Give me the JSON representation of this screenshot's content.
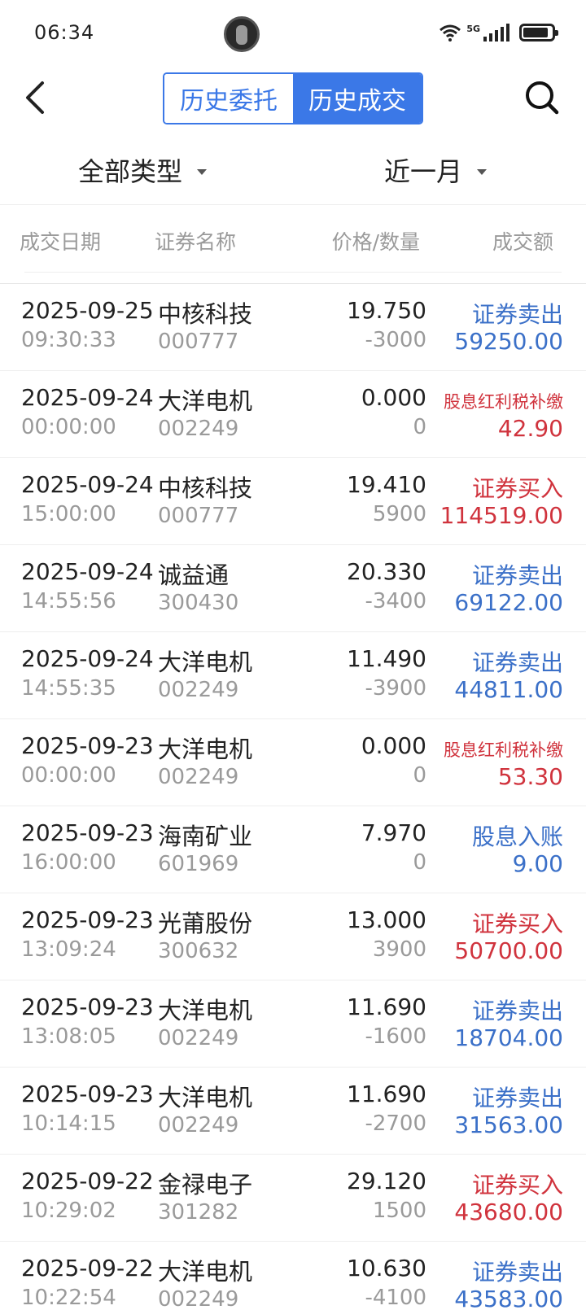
{
  "status": {
    "time": "06:34",
    "network": "5G"
  },
  "header": {
    "tabs": [
      {
        "label": "历史委托",
        "active": false
      },
      {
        "label": "历史成交",
        "active": true
      }
    ],
    "back_icon": "chevron-left-icon",
    "search_icon": "search-icon"
  },
  "filters": {
    "type_label": "全部类型",
    "range_label": "近一月"
  },
  "columns": {
    "date": "成交日期",
    "name": "证券名称",
    "price_qty": "价格/数量",
    "amount": "成交额"
  },
  "colors": {
    "accent": "#3b78e7",
    "sell": "#3b70c8",
    "buy": "#d0333d",
    "muted": "#9a9a9a"
  },
  "rows": [
    {
      "date": "2025-09-25",
      "time": "09:30:33",
      "name": "中核科技",
      "code": "000777",
      "price": "19.750",
      "qty": "-3000",
      "type": "证券卖出",
      "amount": "59250.00",
      "color": "sell"
    },
    {
      "date": "2025-09-24",
      "time": "00:00:00",
      "name": "大洋电机",
      "code": "002249",
      "price": "0.000",
      "qty": "0",
      "type": "股息红利税补缴",
      "amount": "42.90",
      "color": "buy"
    },
    {
      "date": "2025-09-24",
      "time": "15:00:00",
      "name": "中核科技",
      "code": "000777",
      "price": "19.410",
      "qty": "5900",
      "type": "证券买入",
      "amount": "114519.00",
      "color": "buy"
    },
    {
      "date": "2025-09-24",
      "time": "14:55:56",
      "name": "诚益通",
      "code": "300430",
      "price": "20.330",
      "qty": "-3400",
      "type": "证券卖出",
      "amount": "69122.00",
      "color": "sell"
    },
    {
      "date": "2025-09-24",
      "time": "14:55:35",
      "name": "大洋电机",
      "code": "002249",
      "price": "11.490",
      "qty": "-3900",
      "type": "证券卖出",
      "amount": "44811.00",
      "color": "sell"
    },
    {
      "date": "2025-09-23",
      "time": "00:00:00",
      "name": "大洋电机",
      "code": "002249",
      "price": "0.000",
      "qty": "0",
      "type": "股息红利税补缴",
      "amount": "53.30",
      "color": "buy"
    },
    {
      "date": "2025-09-23",
      "time": "16:00:00",
      "name": "海南矿业",
      "code": "601969",
      "price": "7.970",
      "qty": "0",
      "type": "股息入账",
      "amount": "9.00",
      "color": "sell"
    },
    {
      "date": "2025-09-23",
      "time": "13:09:24",
      "name": "光莆股份",
      "code": "300632",
      "price": "13.000",
      "qty": "3900",
      "type": "证券买入",
      "amount": "50700.00",
      "color": "buy"
    },
    {
      "date": "2025-09-23",
      "time": "13:08:05",
      "name": "大洋电机",
      "code": "002249",
      "price": "11.690",
      "qty": "-1600",
      "type": "证券卖出",
      "amount": "18704.00",
      "color": "sell"
    },
    {
      "date": "2025-09-23",
      "time": "10:14:15",
      "name": "大洋电机",
      "code": "002249",
      "price": "11.690",
      "qty": "-2700",
      "type": "证券卖出",
      "amount": "31563.00",
      "color": "sell"
    },
    {
      "date": "2025-09-22",
      "time": "10:29:02",
      "name": "金禄电子",
      "code": "301282",
      "price": "29.120",
      "qty": "1500",
      "type": "证券买入",
      "amount": "43680.00",
      "color": "buy"
    },
    {
      "date": "2025-09-22",
      "time": "10:22:54",
      "name": "大洋电机",
      "code": "002249",
      "price": "10.630",
      "qty": "-4100",
      "type": "证券卖出",
      "amount": "43583.00",
      "color": "sell"
    }
  ]
}
